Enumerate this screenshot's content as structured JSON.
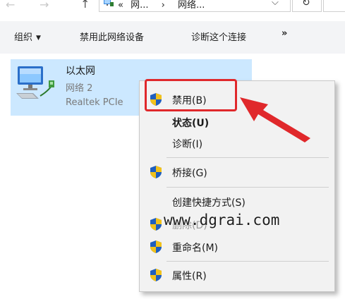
{
  "address_bar": {
    "back_glyph": "←",
    "forward_glyph": "→",
    "up_glyph": "↑",
    "path_prefix": "«",
    "path_segment_1": "网...",
    "path_separator": "›",
    "path_segment_2": "网络...",
    "dropdown_glyph": "⌵",
    "refresh_glyph": "↻"
  },
  "command_bar": {
    "organize_label": "组织",
    "organize_caret": "▼",
    "disable_device_label": "禁用此网络设备",
    "diagnose_label": "诊断这个连接",
    "more_label": "»"
  },
  "network_item": {
    "name": "以太网",
    "network": "网络 2",
    "adapter": "Realtek PCIe"
  },
  "context_menu": {
    "items": [
      {
        "label": "禁用(B)",
        "shield": true
      },
      {
        "label": "状态(U)",
        "shield": false,
        "bold": true
      },
      {
        "label": "诊断(I)",
        "shield": false
      },
      {
        "label": "桥接(G)",
        "shield": true
      },
      {
        "label": "创建快捷方式(S)",
        "shield": false
      },
      {
        "label": "删除(D)",
        "shield": true
      },
      {
        "label": "重命名(M)",
        "shield": true
      },
      {
        "label": "属性(R)",
        "shield": true
      }
    ]
  },
  "watermark": "www.dgrai.com",
  "colors": {
    "selection": "#cce8ff",
    "highlight": "#e0282b",
    "menu_bg": "#f2f2f2"
  }
}
